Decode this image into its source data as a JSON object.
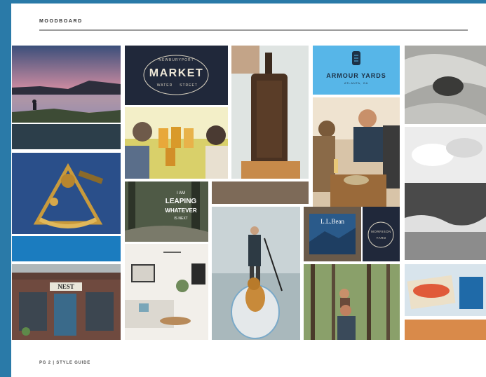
{
  "page": {
    "header": "MOODBOARD",
    "footer": "PG 2  |  STYLE GUIDE"
  },
  "logos": {
    "market": {
      "top": "NEWBURYPORT",
      "main": "MARKET",
      "left": "WATER",
      "right": "STREET"
    },
    "armour": {
      "main": "ARMOUR YARDS",
      "sub": "ATLANTA, GA"
    },
    "leaping": {
      "line1": "I AM",
      "line2": "LEAPING",
      "line3": "WHATEVER",
      "line4": "IS NEXT"
    },
    "llbean": {
      "main": "L.L.Bean"
    },
    "morrison": {
      "main": "MORRISON",
      "sub": "YARD"
    },
    "nest": {
      "main": "NEST"
    }
  },
  "colors": {
    "frame": "#2a7aa8",
    "navy": "#20283a",
    "slate": "#2c3e4a",
    "blue": "#1b7cbf",
    "sky": "#57b6e8",
    "taupe": "#7d6a58",
    "orange": "#d98a4a"
  }
}
